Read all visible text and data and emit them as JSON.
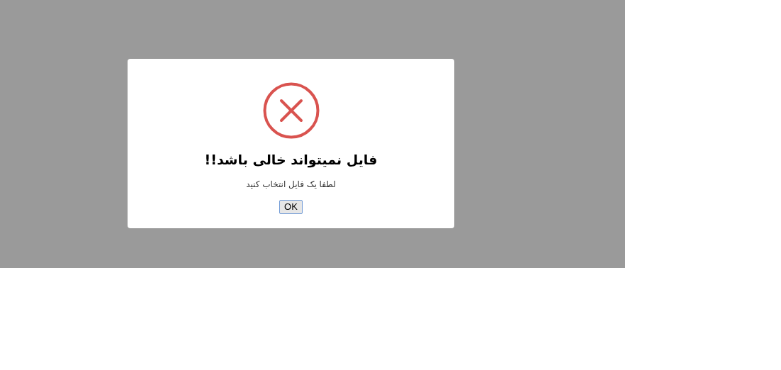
{
  "dialog": {
    "kind": "error",
    "title": "فایل نمیتواند خالی باشد!!",
    "message": "لطفا یک فایل انتخاب کنید",
    "button": "OK"
  }
}
